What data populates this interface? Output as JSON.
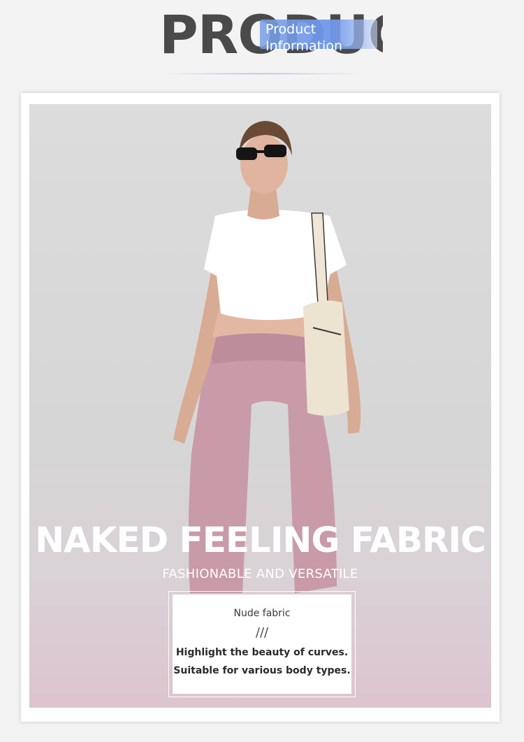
{
  "header": {
    "big_word": "PRODUCT",
    "title": "Product",
    "subtitle": "Information"
  },
  "banner": {
    "headline": "NAKED FEELING FABRIC",
    "subheadline": "FASHIONABLE AND VERSATILE"
  },
  "info_box": {
    "title": "Nude fabric",
    "divider": "///",
    "line1": "Highlight the beauty of curves.",
    "line2": "Suitable for various body types."
  },
  "colors": {
    "page_background": "#f3f3f3",
    "accent_blue": "#7aa0e6",
    "pants_pink": "#c99aa8",
    "heading_text": "#4a4a4a"
  }
}
